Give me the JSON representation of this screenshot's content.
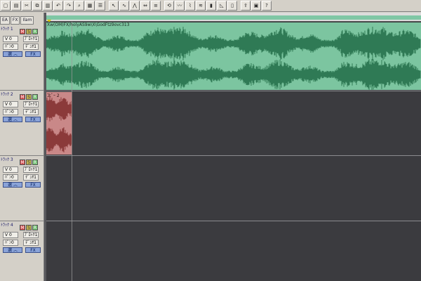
{
  "toolbar": {
    "buttons": [
      {
        "name": "new-file-icon",
        "glyph": "▢"
      },
      {
        "name": "open-icon",
        "glyph": "▤"
      },
      {
        "name": "scissors-icon",
        "glyph": "✂"
      },
      {
        "name": "copy-icon",
        "glyph": "⧉"
      },
      {
        "name": "paste-icon",
        "glyph": "▥"
      },
      {
        "name": "undo-icon",
        "glyph": "↶"
      },
      {
        "name": "redo-icon",
        "glyph": "↷"
      },
      {
        "name": "zoom-icon",
        "glyph": "⌕"
      },
      {
        "name": "grid-icon",
        "glyph": "▦"
      },
      {
        "name": "list-icon",
        "glyph": "☰"
      },
      {
        "name": "sep"
      },
      {
        "name": "cursor-icon",
        "glyph": "↖"
      },
      {
        "name": "wave-icon",
        "glyph": "∿"
      },
      {
        "name": "envelope-icon",
        "glyph": "⋀"
      },
      {
        "name": "range-icon",
        "glyph": "⇔"
      },
      {
        "name": "mixer-icon",
        "glyph": "≡"
      },
      {
        "name": "sep"
      },
      {
        "name": "loop-icon",
        "glyph": "⟲"
      },
      {
        "name": "wave2-icon",
        "glyph": "〰"
      },
      {
        "name": "fx-icon",
        "glyph": "⌇"
      },
      {
        "name": "eq-icon",
        "glyph": "≋"
      },
      {
        "name": "level-icon",
        "glyph": "▮"
      },
      {
        "name": "fade-icon",
        "glyph": "◺"
      },
      {
        "name": "bookmark-icon",
        "glyph": "▯"
      },
      {
        "name": "sep"
      },
      {
        "name": "export-icon",
        "glyph": "⇪"
      },
      {
        "name": "render-icon",
        "glyph": "▣"
      },
      {
        "name": "help-icon",
        "glyph": "?"
      }
    ]
  },
  "view_tabs": [
    "EA",
    "FX",
    "Ilam"
  ],
  "tracks": [
    {
      "label": "ﾄﾗｯｸ 1",
      "m": "M",
      "s": "S",
      "r": "R",
      "vol": "V 0",
      "pan": "ﾊﾟﾝ0",
      "btn1": "ﾌﾞﾛｯｸ1",
      "btn2": "ﾃﾞｭｵ1",
      "sel": "選 ︿",
      "fx": "FX"
    },
    {
      "label": "ﾄﾗｯｸ 2",
      "m": "M",
      "s": "S",
      "r": "R",
      "vol": "V 0",
      "pan": "ﾊﾟﾝ0",
      "btn1": "ﾌﾞﾛｯｸ1",
      "btn2": "ﾃﾞｭｵ1",
      "sel": "選 ︿",
      "fx": "FX"
    },
    {
      "label": "ﾄﾗｯｸ 3",
      "m": "M",
      "s": "S",
      "r": "R",
      "vol": "V 0",
      "pan": "ﾊﾟﾝ0",
      "btn1": "ﾌﾞﾛｯｸ1",
      "btn2": "ﾃﾞｭｵ1",
      "sel": "選 ︿",
      "fx": "FX"
    },
    {
      "label": "ﾄﾗｯｸ 4",
      "m": "M",
      "s": "S",
      "r": "R",
      "vol": "V 0",
      "pan": "ﾊﾟﾝ0",
      "btn1": "ﾌﾞﾛｯｸ1",
      "btn2": "ﾃﾞｭｵ1",
      "sel": "選 ︿",
      "fx": "FX"
    }
  ],
  "clips": {
    "track1_name": "Xw(OM)FX/holyAS9w\\X\\GodFtz9ovc313",
    "track2_name": "ｺﾋﾟｰ 2"
  },
  "colors": {
    "wave_green": "#2f7a55",
    "clip_green": "#7cc5a0",
    "wave_red": "#8b3a3a",
    "clip_red": "#c98888",
    "lane_bg": "#3b3b3f"
  }
}
